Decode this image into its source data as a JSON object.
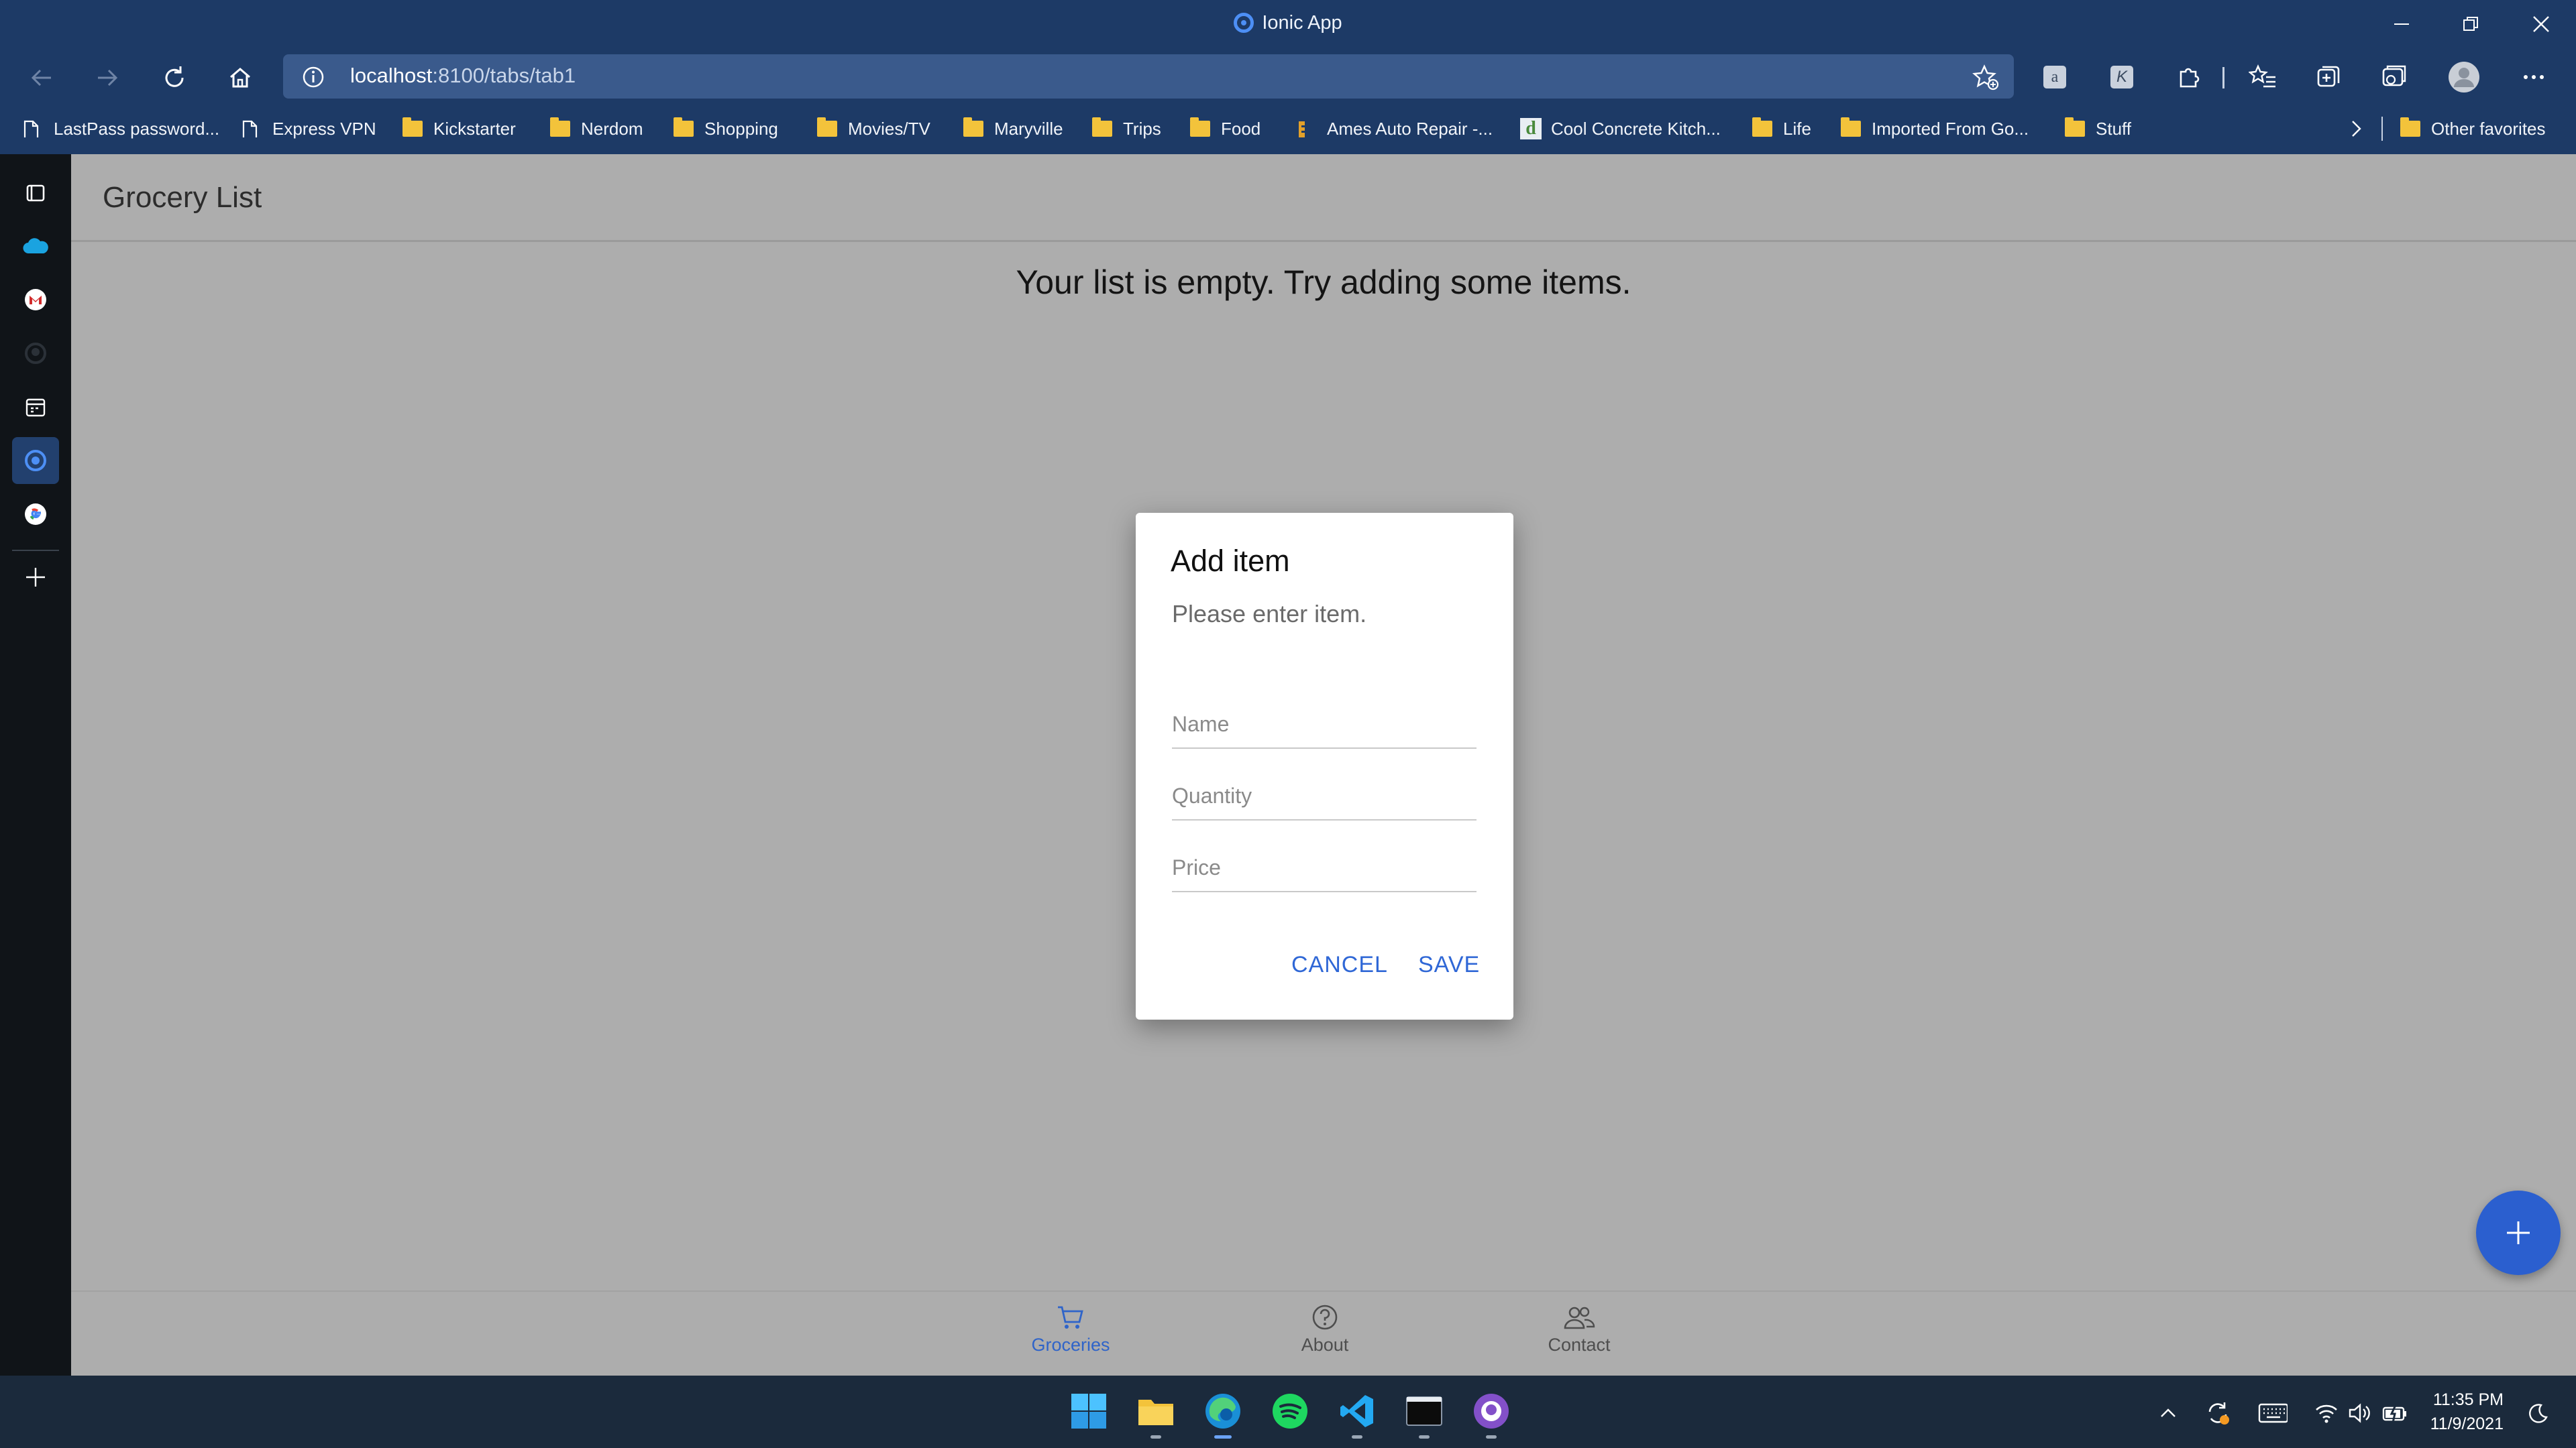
{
  "window": {
    "title": "Ionic App"
  },
  "browser": {
    "url_host": "localhost",
    "url_path": ":8100/tabs/tab1",
    "bookmarks": [
      {
        "label": "LastPass password...",
        "icon": "page-icon"
      },
      {
        "label": "Express VPN",
        "icon": "page-icon"
      },
      {
        "label": "Kickstarter",
        "icon": "folder-icon"
      },
      {
        "label": "Nerdom",
        "icon": "folder-icon"
      },
      {
        "label": "Shopping",
        "icon": "folder-icon"
      },
      {
        "label": "Movies/TV",
        "icon": "folder-icon"
      },
      {
        "label": "Maryville",
        "icon": "folder-icon"
      },
      {
        "label": "Trips",
        "icon": "folder-icon"
      },
      {
        "label": "Food",
        "icon": "folder-icon"
      },
      {
        "label": "Ames Auto Repair -...",
        "icon": "site-icon"
      },
      {
        "label": "Cool Concrete Kitch...",
        "icon": "site-icon"
      },
      {
        "label": "Life",
        "icon": "folder-icon"
      },
      {
        "label": "Imported From Go...",
        "icon": "folder-icon"
      },
      {
        "label": "Stuff",
        "icon": "folder-icon"
      }
    ],
    "other_favorites": "Other favorites"
  },
  "app": {
    "toolbar_title": "Grocery List",
    "empty_message": "Your list is empty. Try adding some items.",
    "tabs": [
      {
        "label": "Groceries",
        "icon": "cart-icon",
        "active": true
      },
      {
        "label": "About",
        "icon": "help-icon",
        "active": false
      },
      {
        "label": "Contact",
        "icon": "people-icon",
        "active": false
      }
    ]
  },
  "dialog": {
    "header": "Add item",
    "message": "Please enter item.",
    "name_placeholder": "Name",
    "name_value": "",
    "quantity_placeholder": "Quantity",
    "quantity_value": "",
    "price_placeholder": "Price",
    "price_value": "",
    "cancel_label": "CANCEL",
    "save_label": "SAVE"
  },
  "taskbar": {
    "time": "11:35 PM",
    "date": "11/9/2021"
  },
  "colors": {
    "browser_chrome": "#1d3a66",
    "accent": "#2f64c9",
    "fab": "#2b5fcf",
    "backdrop": "#adadad"
  }
}
